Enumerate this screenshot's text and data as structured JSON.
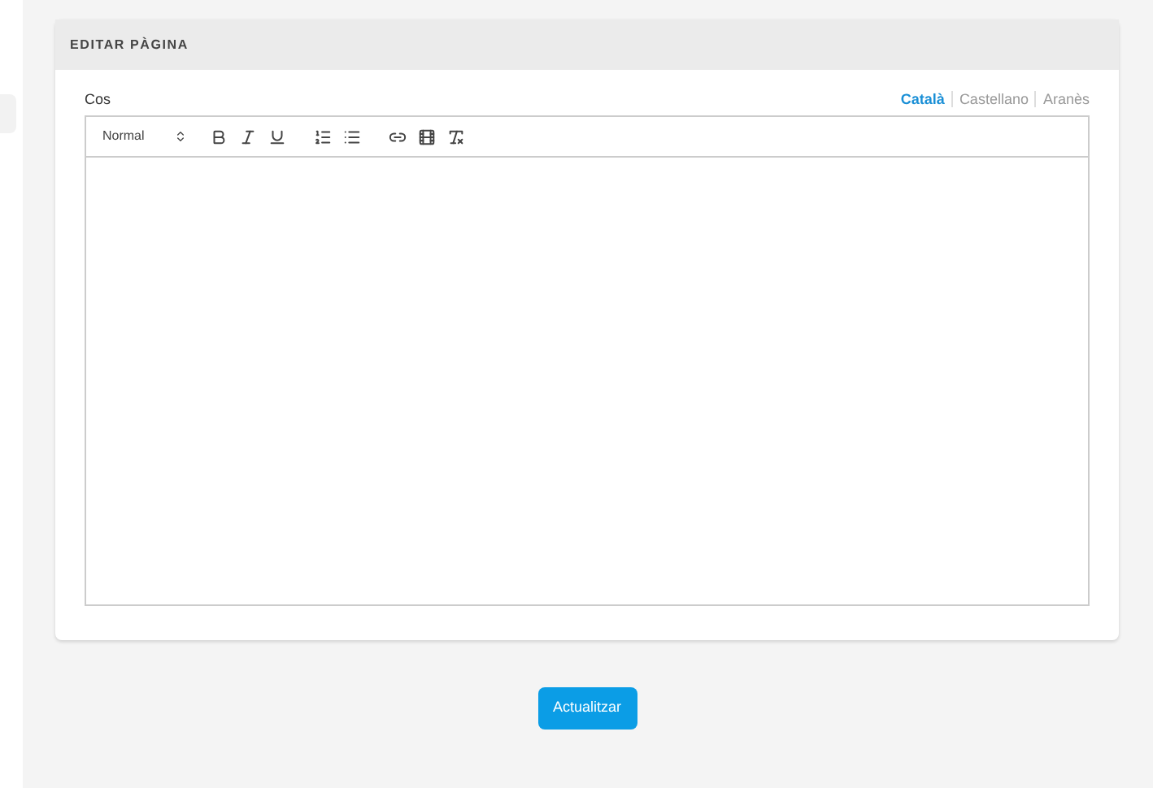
{
  "card": {
    "title": "EDITAR PÀGINA"
  },
  "field": {
    "label": "Cos"
  },
  "languages": [
    {
      "label": "Català",
      "selected": true
    },
    {
      "label": "Castellano",
      "selected": false
    },
    {
      "label": "Aranès",
      "selected": false
    }
  ],
  "toolbar": {
    "format": "Normal"
  },
  "submit": "Actualitzar"
}
